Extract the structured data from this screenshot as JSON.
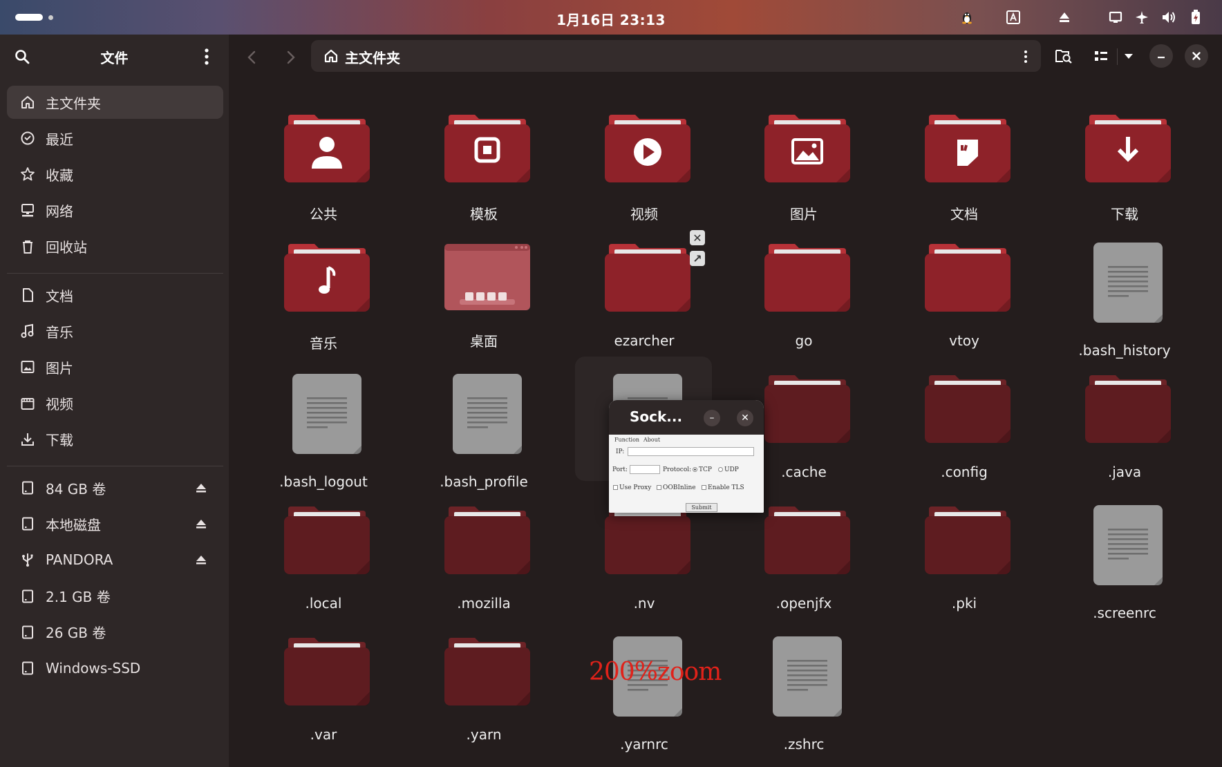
{
  "topbar": {
    "clock": "1月16日  23:13",
    "tray_icons": [
      "tux-icon",
      "input-method-icon",
      "eject-icon",
      "screen-icon",
      "airplane-icon",
      "volume-icon",
      "battery-icon"
    ]
  },
  "sidebar": {
    "title": "文件",
    "places": [
      {
        "label": "主文件夹",
        "icon": "home-icon",
        "active": true
      },
      {
        "label": "最近",
        "icon": "recent-icon"
      },
      {
        "label": "收藏",
        "icon": "star-icon"
      },
      {
        "label": "网络",
        "icon": "network-icon"
      },
      {
        "label": "回收站",
        "icon": "trash-icon"
      }
    ],
    "bookmarks": [
      {
        "label": "文档",
        "icon": "document-icon"
      },
      {
        "label": "音乐",
        "icon": "music-icon"
      },
      {
        "label": "图片",
        "icon": "image-icon"
      },
      {
        "label": "视频",
        "icon": "video-icon"
      },
      {
        "label": "下载",
        "icon": "download-icon"
      }
    ],
    "devices": [
      {
        "label": "84 GB 卷",
        "icon": "drive-icon",
        "eject": true
      },
      {
        "label": "本地磁盘",
        "icon": "drive-icon",
        "eject": true
      },
      {
        "label": "PANDORA",
        "icon": "usb-icon",
        "eject": true
      },
      {
        "label": "2.1 GB 卷",
        "icon": "drive-icon",
        "eject": false
      },
      {
        "label": "26 GB 卷",
        "icon": "drive-icon",
        "eject": false
      },
      {
        "label": "Windows-SSD",
        "icon": "drive-icon",
        "eject": false
      }
    ]
  },
  "header": {
    "path": "主文件夹"
  },
  "files": [
    {
      "name": "公共",
      "type": "folder",
      "emblem": "person",
      "hidden": false
    },
    {
      "name": "模板",
      "type": "folder",
      "emblem": "template",
      "hidden": false
    },
    {
      "name": "视频",
      "type": "folder",
      "emblem": "play",
      "hidden": false
    },
    {
      "name": "图片",
      "type": "folder",
      "emblem": "picture",
      "hidden": false
    },
    {
      "name": "文档",
      "type": "folder",
      "emblem": "docs",
      "hidden": false
    },
    {
      "name": "下载",
      "type": "folder",
      "emblem": "download",
      "hidden": false
    },
    {
      "name": "音乐",
      "type": "folder",
      "emblem": "music",
      "hidden": false
    },
    {
      "name": "桌面",
      "type": "desktop",
      "emblem": "",
      "hidden": false
    },
    {
      "name": "ezarcher",
      "type": "folder",
      "emblem": "",
      "hidden": false
    },
    {
      "name": "go",
      "type": "folder",
      "emblem": "",
      "hidden": false
    },
    {
      "name": "vtoy",
      "type": "folder",
      "emblem": "",
      "hidden": false
    },
    {
      "name": ".bash_history",
      "type": "file",
      "emblem": "",
      "hidden": false
    },
    {
      "name": ".bash_logout",
      "type": "file",
      "emblem": "",
      "hidden": false
    },
    {
      "name": ".bash_profile",
      "type": "file",
      "emblem": "",
      "hidden": false
    },
    {
      "name": "",
      "type": "file",
      "emblem": "",
      "hidden": false
    },
    {
      "name": ".cache",
      "type": "folder",
      "emblem": "",
      "hidden": true
    },
    {
      "name": ".config",
      "type": "folder",
      "emblem": "",
      "hidden": true
    },
    {
      "name": ".java",
      "type": "folder",
      "emblem": "",
      "hidden": true
    },
    {
      "name": ".local",
      "type": "folder",
      "emblem": "",
      "hidden": true
    },
    {
      "name": ".mozilla",
      "type": "folder",
      "emblem": "",
      "hidden": true
    },
    {
      "name": ".nv",
      "type": "folder",
      "emblem": "",
      "hidden": true
    },
    {
      "name": ".openjfx",
      "type": "folder",
      "emblem": "",
      "hidden": true
    },
    {
      "name": ".pki",
      "type": "folder",
      "emblem": "",
      "hidden": true
    },
    {
      "name": ".screenrc",
      "type": "file",
      "emblem": "",
      "hidden": false
    },
    {
      "name": ".var",
      "type": "folder",
      "emblem": "",
      "hidden": true
    },
    {
      "name": ".yarn",
      "type": "folder",
      "emblem": "",
      "hidden": true
    },
    {
      "name": ".yarnrc",
      "type": "file",
      "emblem": "",
      "hidden": false
    },
    {
      "name": ".zshrc",
      "type": "file",
      "emblem": "",
      "hidden": false
    }
  ],
  "popup": {
    "title": "Sock...",
    "menu_function": "Function",
    "menu_about": "About",
    "ip_label": "IP:",
    "ip_value": "",
    "port_label": "Port:",
    "port_value": "",
    "protocol_label": "Protocol:",
    "tcp_label": "TCP",
    "udp_label": "UDP",
    "use_proxy_label": "Use Proxy",
    "oobinline_label": "OOBInline",
    "enable_tls_label": "Enable TLS",
    "submit_label": "Submit"
  },
  "zoom_note": "200%zoom",
  "colors": {
    "folder": "#8e2229",
    "folder_hidden": "#5e1c20",
    "folder_tab": "#b83238",
    "sidebar_bg": "#2e2727",
    "main_bg": "#241d1d"
  }
}
